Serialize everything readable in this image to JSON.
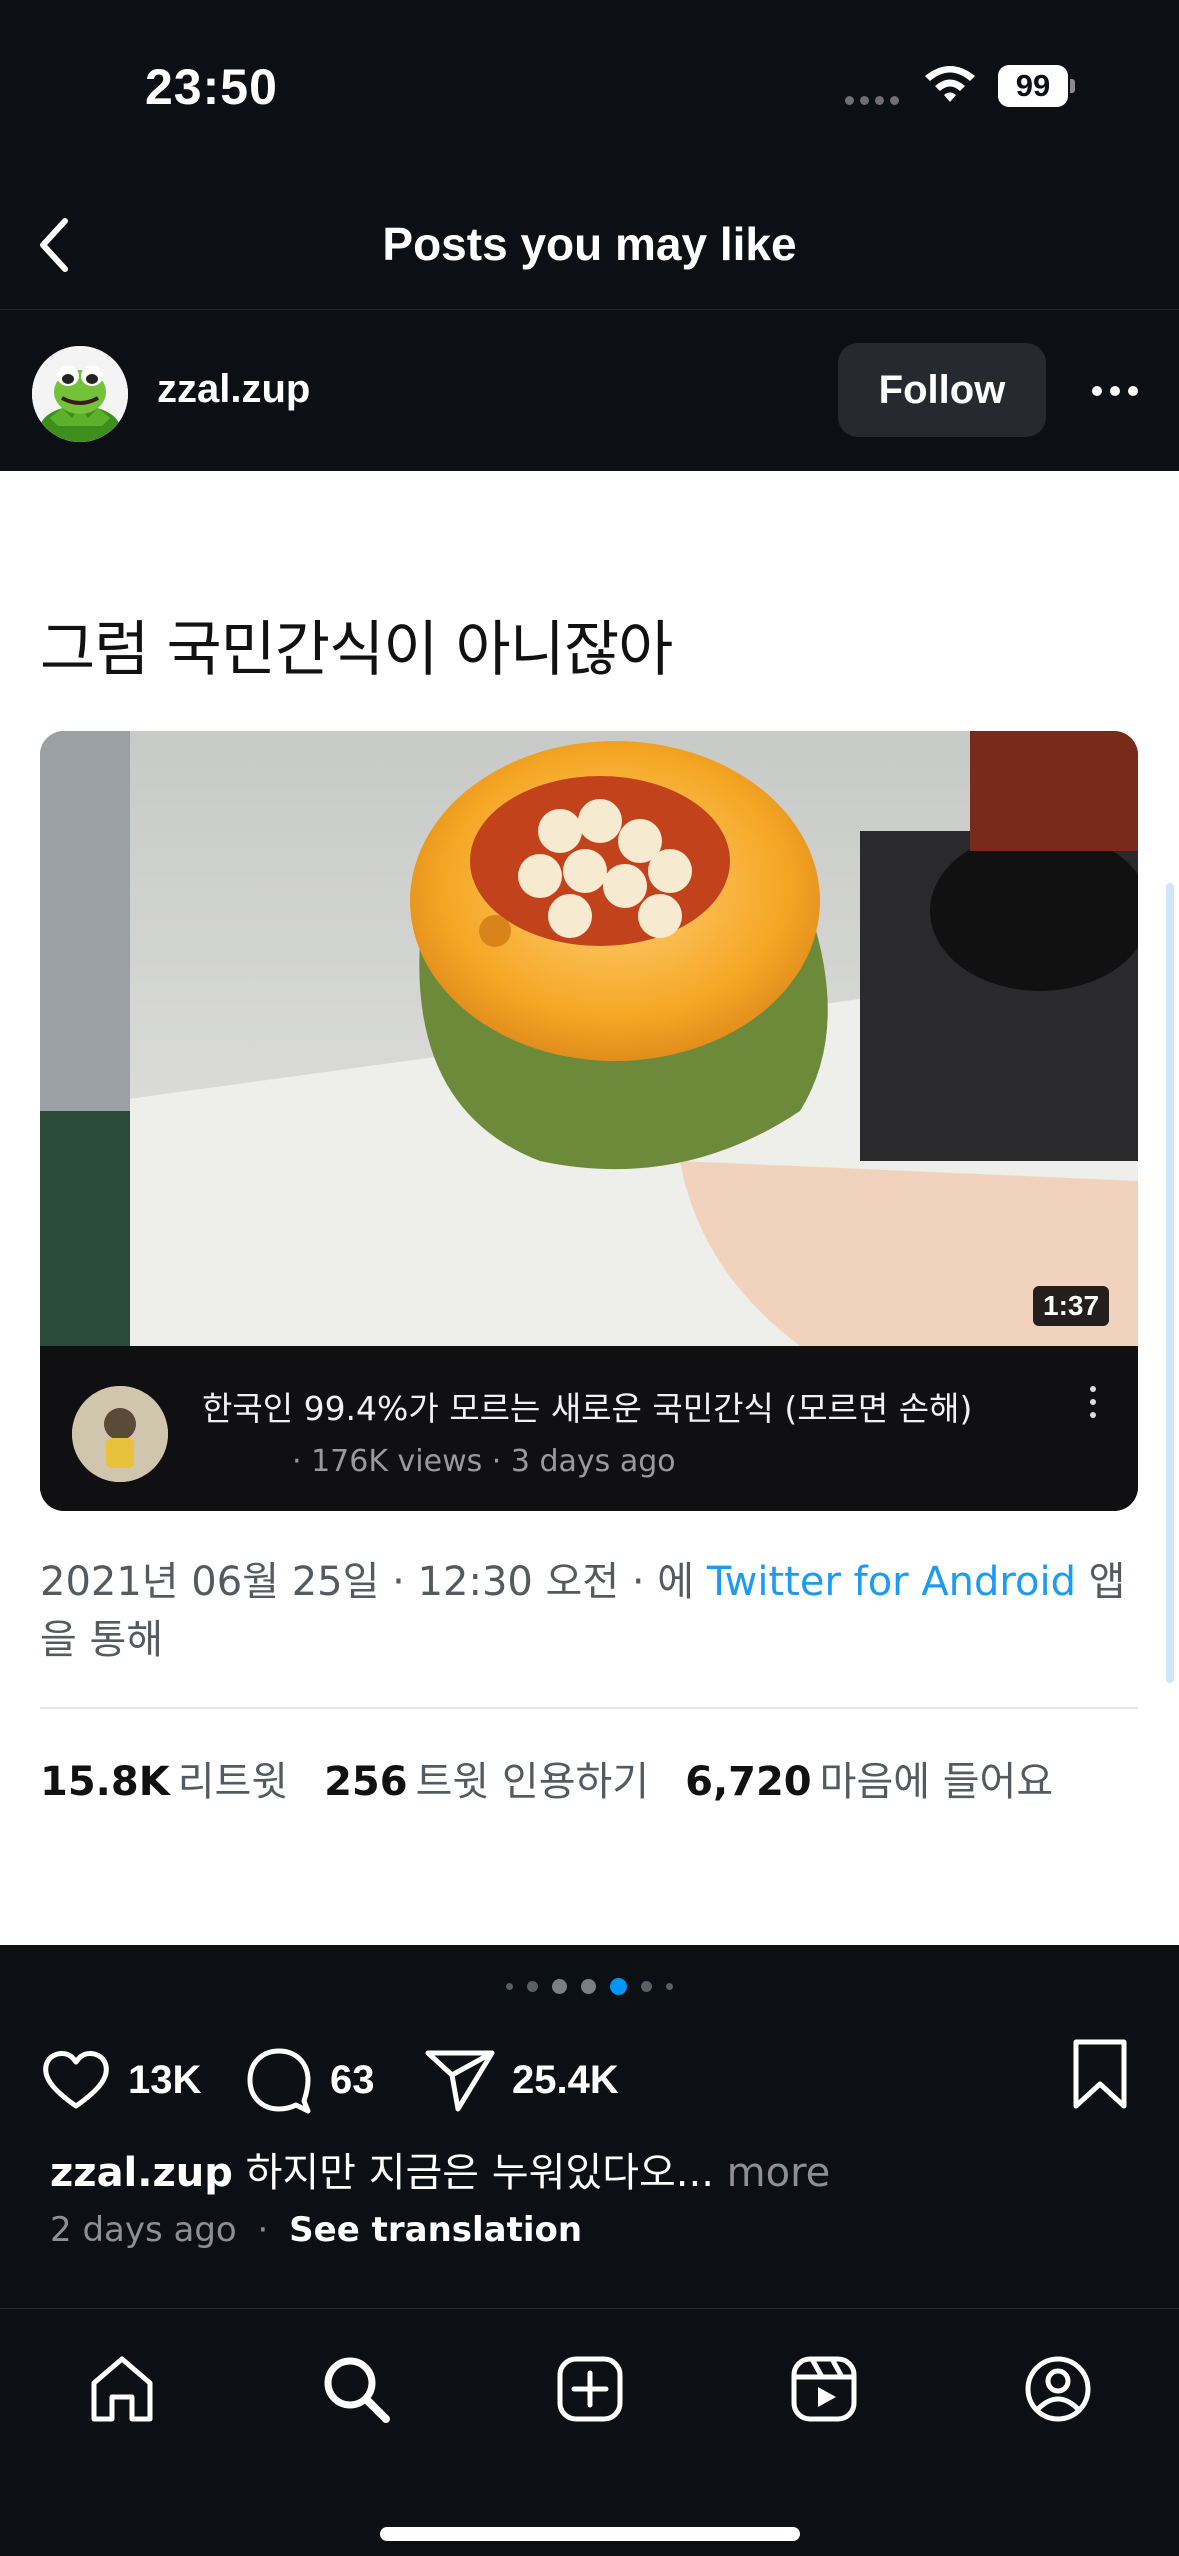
{
  "status_bar": {
    "time": "23:50",
    "battery": "99"
  },
  "header": {
    "title": "Posts you may like"
  },
  "post": {
    "username": "zzal.zup",
    "follow_label": "Follow",
    "image": {
      "tweet_text": "그럼 국민간식이 아니잖아",
      "video": {
        "duration": "1:37",
        "title": "한국인 99.4%가 모르는 새로운 국민간식 (모르면 손해)",
        "sub": "· 176K views · 3 days ago"
      },
      "meta_prefix": "2021년 06월 25일 · 12:30 오전 · 에 ",
      "meta_link": "Twitter for Android",
      "meta_suffix": " 앱을 통해",
      "stats": [
        {
          "value": "15.8K",
          "label": "리트윗"
        },
        {
          "value": "256",
          "label": "트윗 인용하기"
        },
        {
          "value": "6,720",
          "label": "마음에 들어요"
        }
      ]
    },
    "carousel": {
      "count": 7,
      "active_index": 4
    },
    "likes": "13K",
    "comments": "63",
    "shares": "25.4K",
    "caption_user": "zzal.zup",
    "caption_text": " 하지만 지금은 누워있다오...",
    "caption_more": " more",
    "posted": "2 days ago",
    "separator": "·",
    "see_translation": "See translation"
  },
  "colors": {
    "background": "#0c1014",
    "accent": "#0095f6",
    "follow_bg": "#262a30",
    "twitter_link": "#1d9bf0"
  },
  "nav": [
    "home-icon",
    "search-icon",
    "create-icon",
    "reels-icon",
    "profile-icon"
  ]
}
